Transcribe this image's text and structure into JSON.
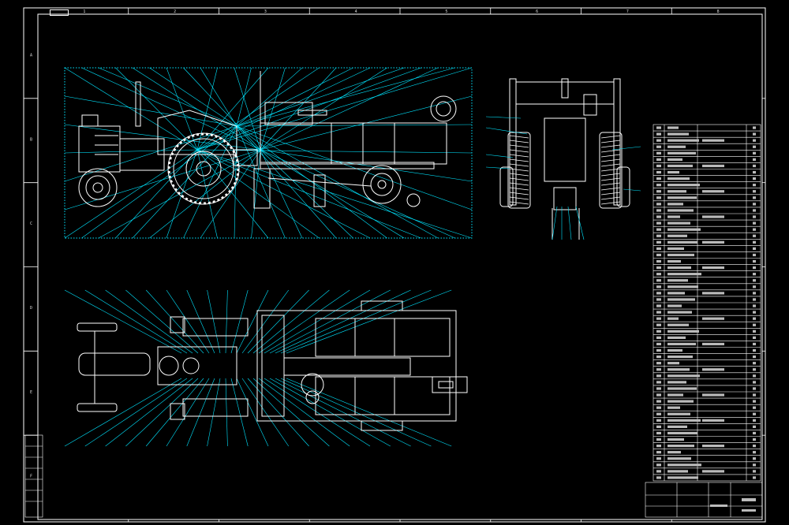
{
  "colors": {
    "background": "#000000",
    "frame": "#ffffff",
    "callout": "#00e5ff",
    "annotation": "#00d2ff"
  },
  "border": {
    "columns": [
      "1",
      "2",
      "3",
      "4",
      "5",
      "6",
      "7",
      "8"
    ],
    "rows": [
      "A",
      "B",
      "C",
      "D",
      "E",
      "F"
    ]
  },
  "views": [
    {
      "name": "side-elevation-view",
      "callouts": 60
    },
    {
      "name": "front-elevation-view",
      "callouts": 10
    },
    {
      "name": "top-plan-view",
      "callouts": 40
    }
  ],
  "bom": {
    "rows": 56
  }
}
